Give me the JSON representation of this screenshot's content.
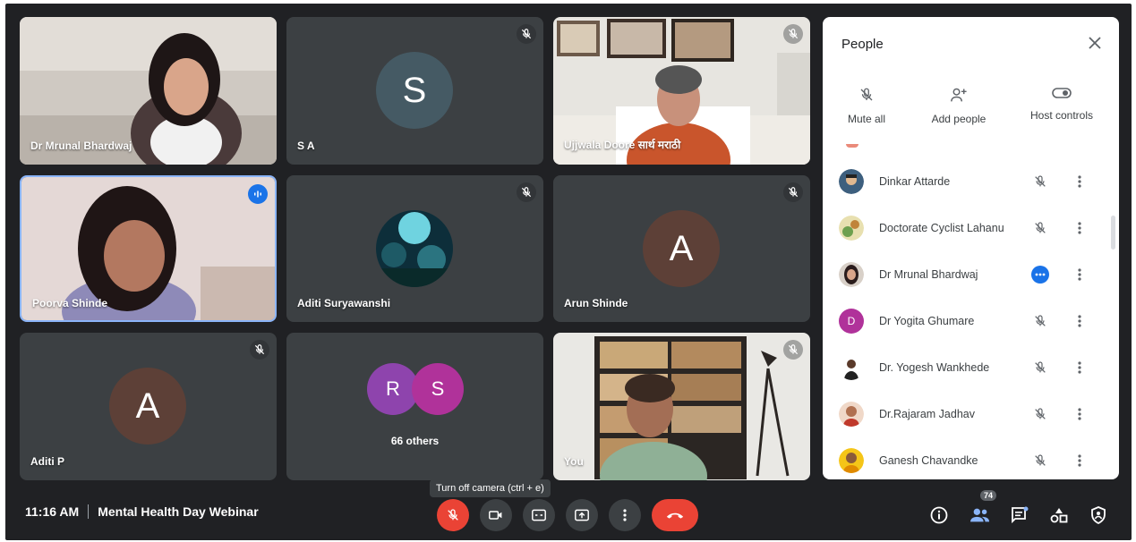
{
  "tiles": {
    "t1": {
      "name": "Dr Mrunal Bhardwaj"
    },
    "t2": {
      "name": "S A",
      "initial": "S"
    },
    "t3": {
      "name": "Ujjwala Doore सार्थ मराठी"
    },
    "t4": {
      "name": "Poorva Shinde"
    },
    "t5": {
      "name": "Aditi Suryawanshi"
    },
    "t6": {
      "name": "Arun Shinde",
      "initial": "A"
    },
    "t7": {
      "name": "Aditi P",
      "initial": "A"
    },
    "t8": {
      "initials": [
        "R",
        "S"
      ],
      "others": "66 others"
    },
    "t9": {
      "name": "You"
    }
  },
  "bottom_bar": {
    "time": "11:16 AM",
    "meeting_title": "Mental Health Day Webinar",
    "tooltip": "Turn off camera (ctrl + e)",
    "people_count": "74"
  },
  "people_panel": {
    "title": "People",
    "actions": {
      "mute_all": "Mute all",
      "add_people": "Add people",
      "host_controls": "Host controls"
    },
    "participants": [
      {
        "name": "Dinkar Attarde"
      },
      {
        "name": "Doctorate Cyclist Lahanu"
      },
      {
        "name": "Dr Mrunal Bhardwaj"
      },
      {
        "name": "Dr Yogita Ghumare",
        "initial": "D"
      },
      {
        "name": "Dr. Yogesh Wankhede"
      },
      {
        "name": "Dr.Rajaram Jadhav"
      },
      {
        "name": "Ganesh Chavandke"
      }
    ]
  },
  "colors": {
    "background": "#202124",
    "tile": "#3c4043",
    "red": "#ea4335",
    "blue": "#1a73e8",
    "avatar_brown": "#5d4037",
    "avatar_teal": "#455a64",
    "avatar_purple": "#8e44ad",
    "avatar_magenta": "#b0329a"
  }
}
